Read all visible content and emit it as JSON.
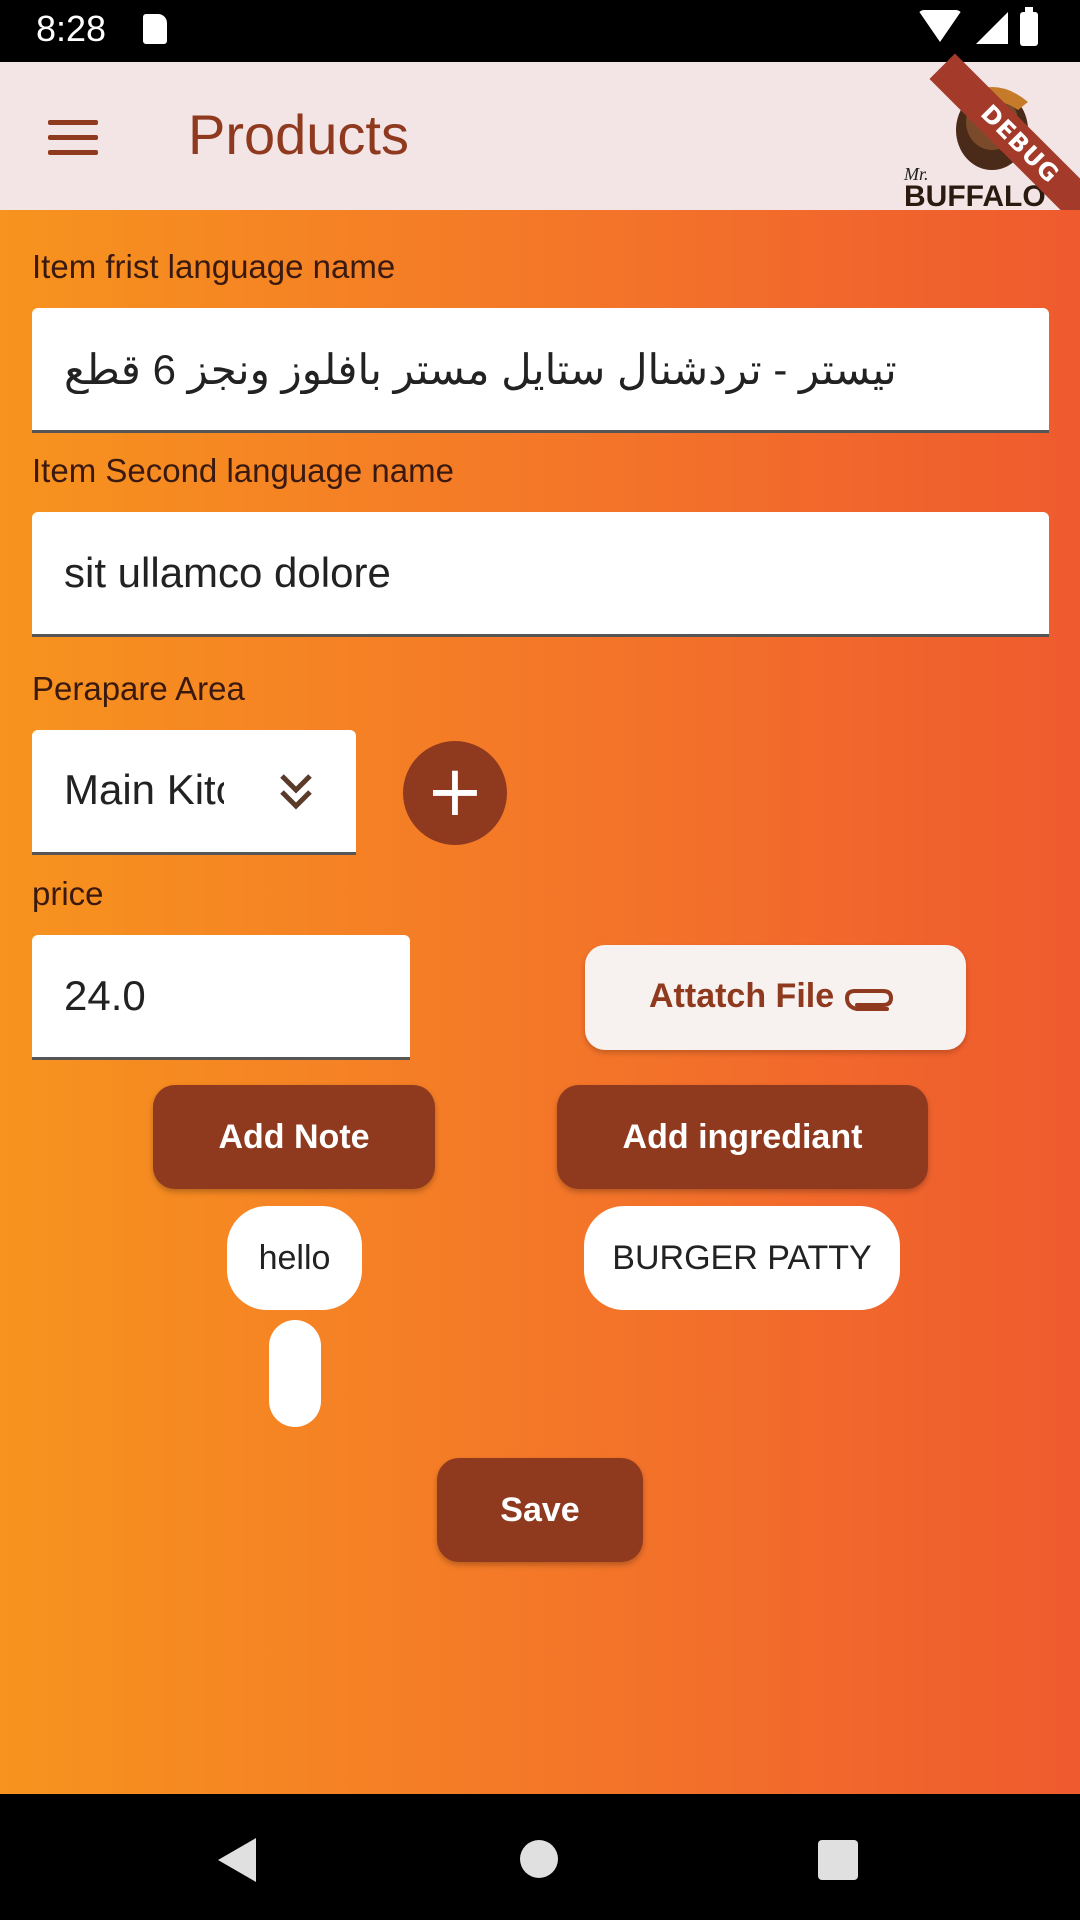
{
  "status": {
    "time": "8:28"
  },
  "appbar": {
    "title": "Products",
    "logo_text": "BUFFALO'S",
    "logo_script": "Mr.",
    "debug": "DEBUG"
  },
  "form": {
    "first_name_label": "Item frist language name",
    "first_name_value": "تيستر - تردشنال ستايل مستر بافلوز ونجز 6 قطع",
    "second_name_label": "Item Second language name",
    "second_name_value": "sit ullamco dolore",
    "area_label": "Perapare Area",
    "area_value": "Main Kitchen",
    "price_label": "price",
    "price_value": "24.0",
    "attach_label": "Attatch File",
    "add_note_label": "Add Note",
    "add_ingredient_label": "Add ingrediant",
    "notes": [
      "hello",
      ""
    ],
    "ingredients": [
      "BURGER PATTY"
    ],
    "save_label": "Save"
  },
  "colors": {
    "accent": "#8f3a1e",
    "appbar_bg": "#f3e4e5",
    "gradient_start": "#f7931e",
    "gradient_end": "#ef5a2e"
  }
}
